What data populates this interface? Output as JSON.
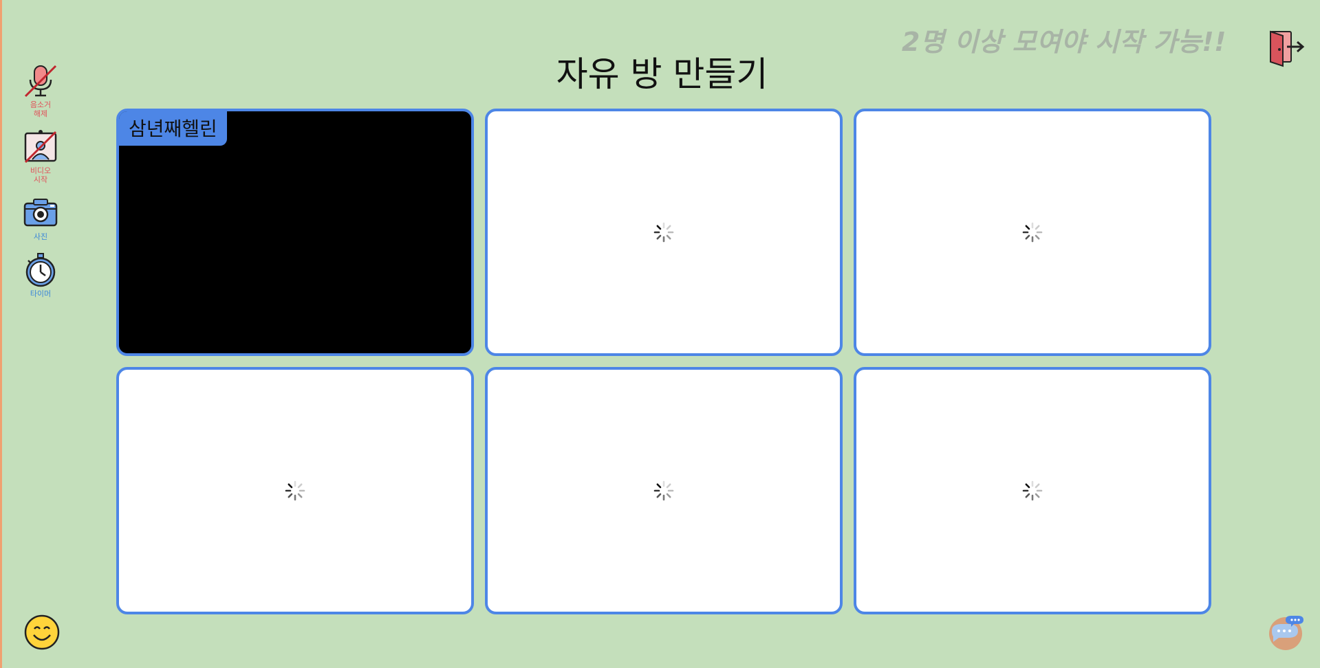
{
  "room": {
    "title": "자유 방 만들기",
    "warning": "2명 이상 모여야 시작 가능!!"
  },
  "sidebar": {
    "items": [
      {
        "label": "음소거\n해제",
        "icon": "muted-microphone-icon",
        "color": "#e0525a"
      },
      {
        "label": "비디오\n시작",
        "icon": "video-off-icon",
        "color": "#e0525a"
      },
      {
        "label": "사진",
        "icon": "camera-icon",
        "color": "#3a86d9"
      },
      {
        "label": "타이머",
        "icon": "stopwatch-icon",
        "color": "#3a86d9"
      }
    ]
  },
  "tiles": [
    {
      "name": "삼년째헬린",
      "state": "video-off"
    },
    {
      "state": "loading"
    },
    {
      "state": "loading"
    },
    {
      "state": "loading"
    },
    {
      "state": "loading"
    },
    {
      "state": "loading"
    }
  ],
  "icons": {
    "exit": "exit-door-icon",
    "emoji": "smile-emoji-icon",
    "chat": "chat-bubble-icon"
  },
  "colors": {
    "background": "#c4dfbb",
    "accent": "#4d86e6",
    "warning_text": "#a8b4a6",
    "danger": "#e0525a"
  }
}
